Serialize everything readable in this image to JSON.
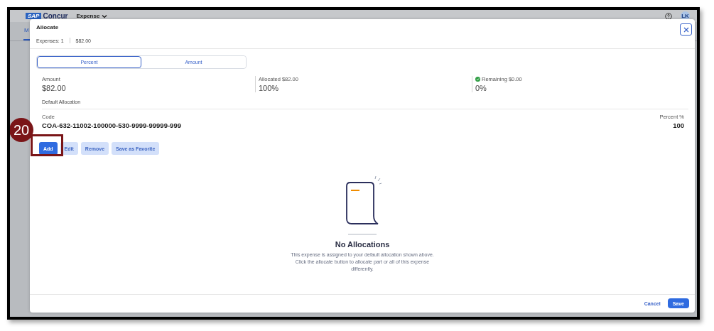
{
  "app_bar": {
    "logo_mark": "SAP",
    "logo": "Concur",
    "product_menu": "Expense",
    "avatar": "LK",
    "tab": "M"
  },
  "dialog": {
    "title": "Allocate",
    "expenses_count": "Expenses: 1",
    "expenses_total": "$82.00",
    "modes": [
      {
        "label": "Percent",
        "selected": true
      },
      {
        "label": "Amount",
        "selected": false
      }
    ],
    "summary": [
      {
        "label": "Amount",
        "value": "$82.00",
        "ok": false
      },
      {
        "label": "Allocated $82.00",
        "value": "100%",
        "ok": false
      },
      {
        "label": "Remaining $0.00",
        "value": "0%",
        "ok": true
      }
    ],
    "default_allocation": {
      "heading": "Default Allocation",
      "code_label": "Code",
      "code": "COA-632-11002-100000-530-9999-99999-999",
      "percent_label": "Percent %",
      "percent": "100"
    },
    "actions": [
      {
        "label": "Add",
        "disabled": false
      },
      {
        "label": "Edit",
        "disabled": true
      },
      {
        "label": "Remove",
        "disabled": true
      },
      {
        "label": "Save as Favorite",
        "disabled": true
      }
    ],
    "empty_state": {
      "title": "No Allocations",
      "message": "This expense is assigned to your default allocation shown above. Click the allocate button to allocate part or all of this expense differently."
    },
    "footer": {
      "cancel": "Cancel",
      "save": "Save"
    }
  },
  "callout": {
    "number": "20"
  }
}
